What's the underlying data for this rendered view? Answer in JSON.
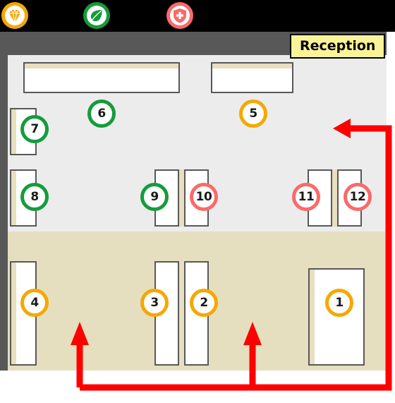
{
  "header": {
    "background": "#000000",
    "icons": [
      {
        "name": "gem-icon",
        "label": "Jewelry",
        "color": "#F5A800"
      },
      {
        "name": "leaf-icon",
        "label": "Organic",
        "color": "#159C3C"
      },
      {
        "name": "health-shield-icon",
        "label": "Health",
        "color": "#FA6A6A"
      }
    ]
  },
  "plan": {
    "reception_label": "Reception",
    "zones": [
      {
        "name": "dry-goods-zone",
        "color": "#ECECEC"
      },
      {
        "name": "fresh-goods-zone",
        "color": "#E5DFBF"
      }
    ],
    "wall_color": "#585858",
    "marker_colors": {
      "green": "#159C3C",
      "orange": "#F5A800",
      "red": "#FA6A6A"
    },
    "route_color": "#FF0000",
    "shelves": [
      {
        "id": "1",
        "label": "1",
        "marker": "orange"
      },
      {
        "id": "2",
        "label": "2",
        "marker": "orange"
      },
      {
        "id": "3",
        "label": "3",
        "marker": "orange"
      },
      {
        "id": "4",
        "label": "4",
        "marker": "orange"
      },
      {
        "id": "5",
        "label": "5",
        "marker": "orange"
      },
      {
        "id": "6",
        "label": "6",
        "marker": "green"
      },
      {
        "id": "7",
        "label": "7",
        "marker": "green"
      },
      {
        "id": "8",
        "label": "8",
        "marker": "green"
      },
      {
        "id": "9",
        "label": "9",
        "marker": "green"
      },
      {
        "id": "10",
        "label": "10",
        "marker": "red"
      },
      {
        "id": "11",
        "label": "11",
        "marker": "red"
      },
      {
        "id": "12",
        "label": "12",
        "marker": "red"
      }
    ]
  }
}
